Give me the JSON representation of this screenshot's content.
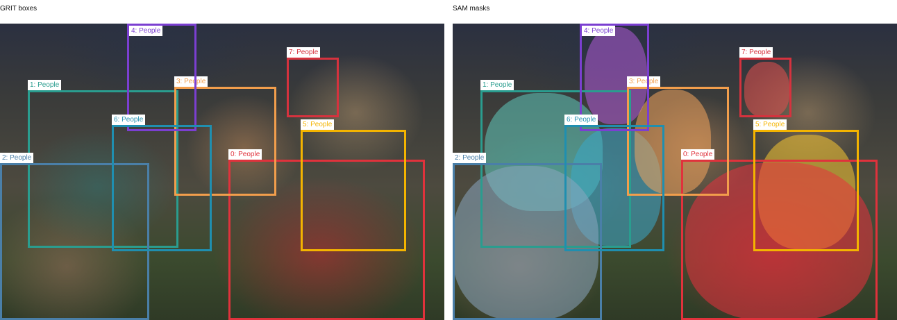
{
  "panels": [
    {
      "title": "GRIT boxes",
      "boxes": [
        {
          "label": "0: People",
          "color": "#e0323c"
        },
        {
          "label": "1: People",
          "color": "#2a9d8f"
        },
        {
          "label": "2: People",
          "color": "#4a7fa8"
        },
        {
          "label": "3: People",
          "color": "#f29e4c"
        },
        {
          "label": "4: People",
          "color": "#7b3fd1"
        },
        {
          "label": "5: People",
          "color": "#f4b400"
        },
        {
          "label": "6: People",
          "color": "#1f8fb0"
        },
        {
          "label": "7: People",
          "color": "#d6323e"
        }
      ]
    },
    {
      "title": "SAM masks",
      "boxes": [
        {
          "label": "0: People",
          "color": "#e0323c"
        },
        {
          "label": "1: People",
          "color": "#2a9d8f"
        },
        {
          "label": "2: People",
          "color": "#4a7fa8"
        },
        {
          "label": "3: People",
          "color": "#f29e4c"
        },
        {
          "label": "4: People",
          "color": "#7b3fd1"
        },
        {
          "label": "5: People",
          "color": "#f4b400"
        },
        {
          "label": "6: People",
          "color": "#1f8fb0"
        },
        {
          "label": "7: People",
          "color": "#d6323e"
        }
      ]
    }
  ]
}
